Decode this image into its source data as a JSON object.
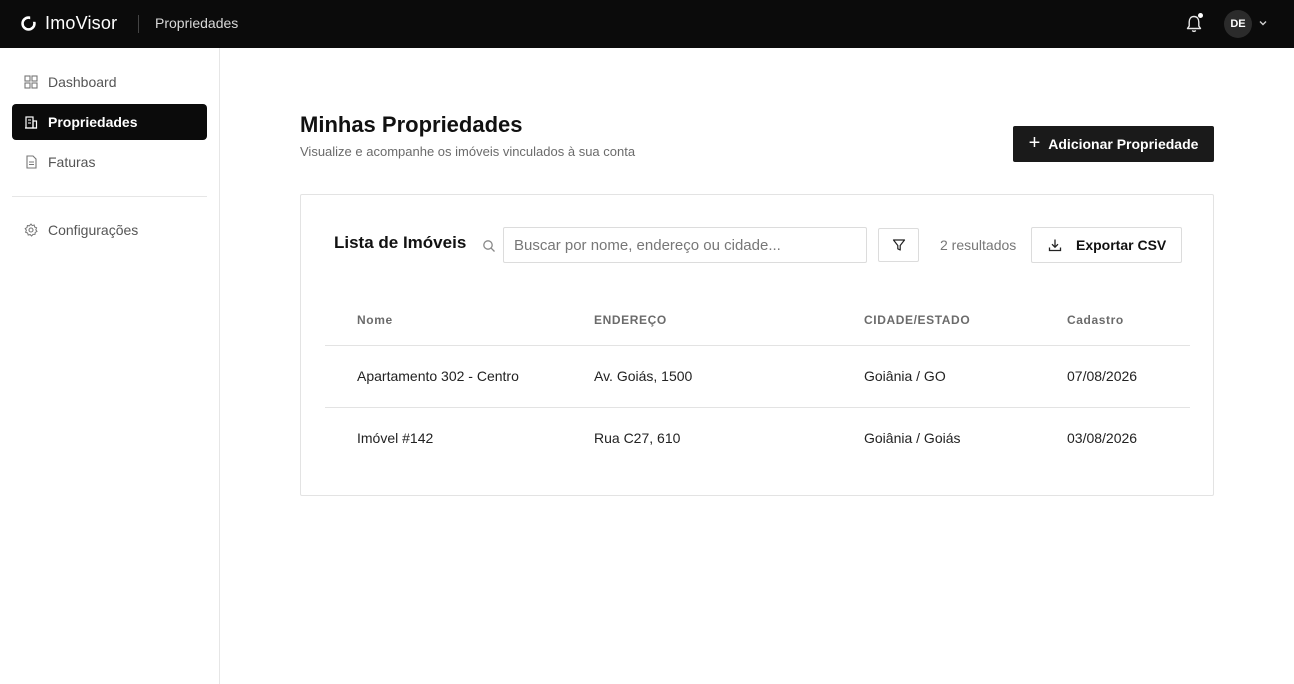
{
  "app": {
    "name": "ImoVisor",
    "section": "Propriedades"
  },
  "user": {
    "initials": "DE"
  },
  "sidebar": {
    "items": [
      {
        "label": "Dashboard",
        "icon": "grid-icon"
      },
      {
        "label": "Propriedades",
        "icon": "building-icon",
        "active": true
      },
      {
        "label": "Faturas",
        "icon": "document-icon"
      },
      {
        "label": "Configurações",
        "icon": "gear-icon"
      }
    ]
  },
  "page": {
    "title": "Minhas Propriedades",
    "subtitle": "Visualize e acompanhe os imóveis vinculados à sua conta",
    "add_button": "Adicionar Propriedade"
  },
  "list": {
    "title": "Lista de Imóveis",
    "search_placeholder": "Buscar por nome, endereço ou cidade...",
    "results": "2 resultados",
    "export_button": "Exportar CSV",
    "columns": [
      "Nome",
      "ENDEREÇO",
      "CIDADE/ESTADO",
      "Cadastro"
    ],
    "rows": [
      {
        "nome": "Apartamento 302 - Centro",
        "endereco": "Av. Goiás, 1500",
        "cidade": "Goiânia / GO",
        "cadastro": "07/08/2026"
      },
      {
        "nome": "Imóvel #142",
        "endereco": "Rua C27, 610",
        "cidade": "Goiânia / Goiás",
        "cadastro": "03/08/2026"
      }
    ]
  }
}
